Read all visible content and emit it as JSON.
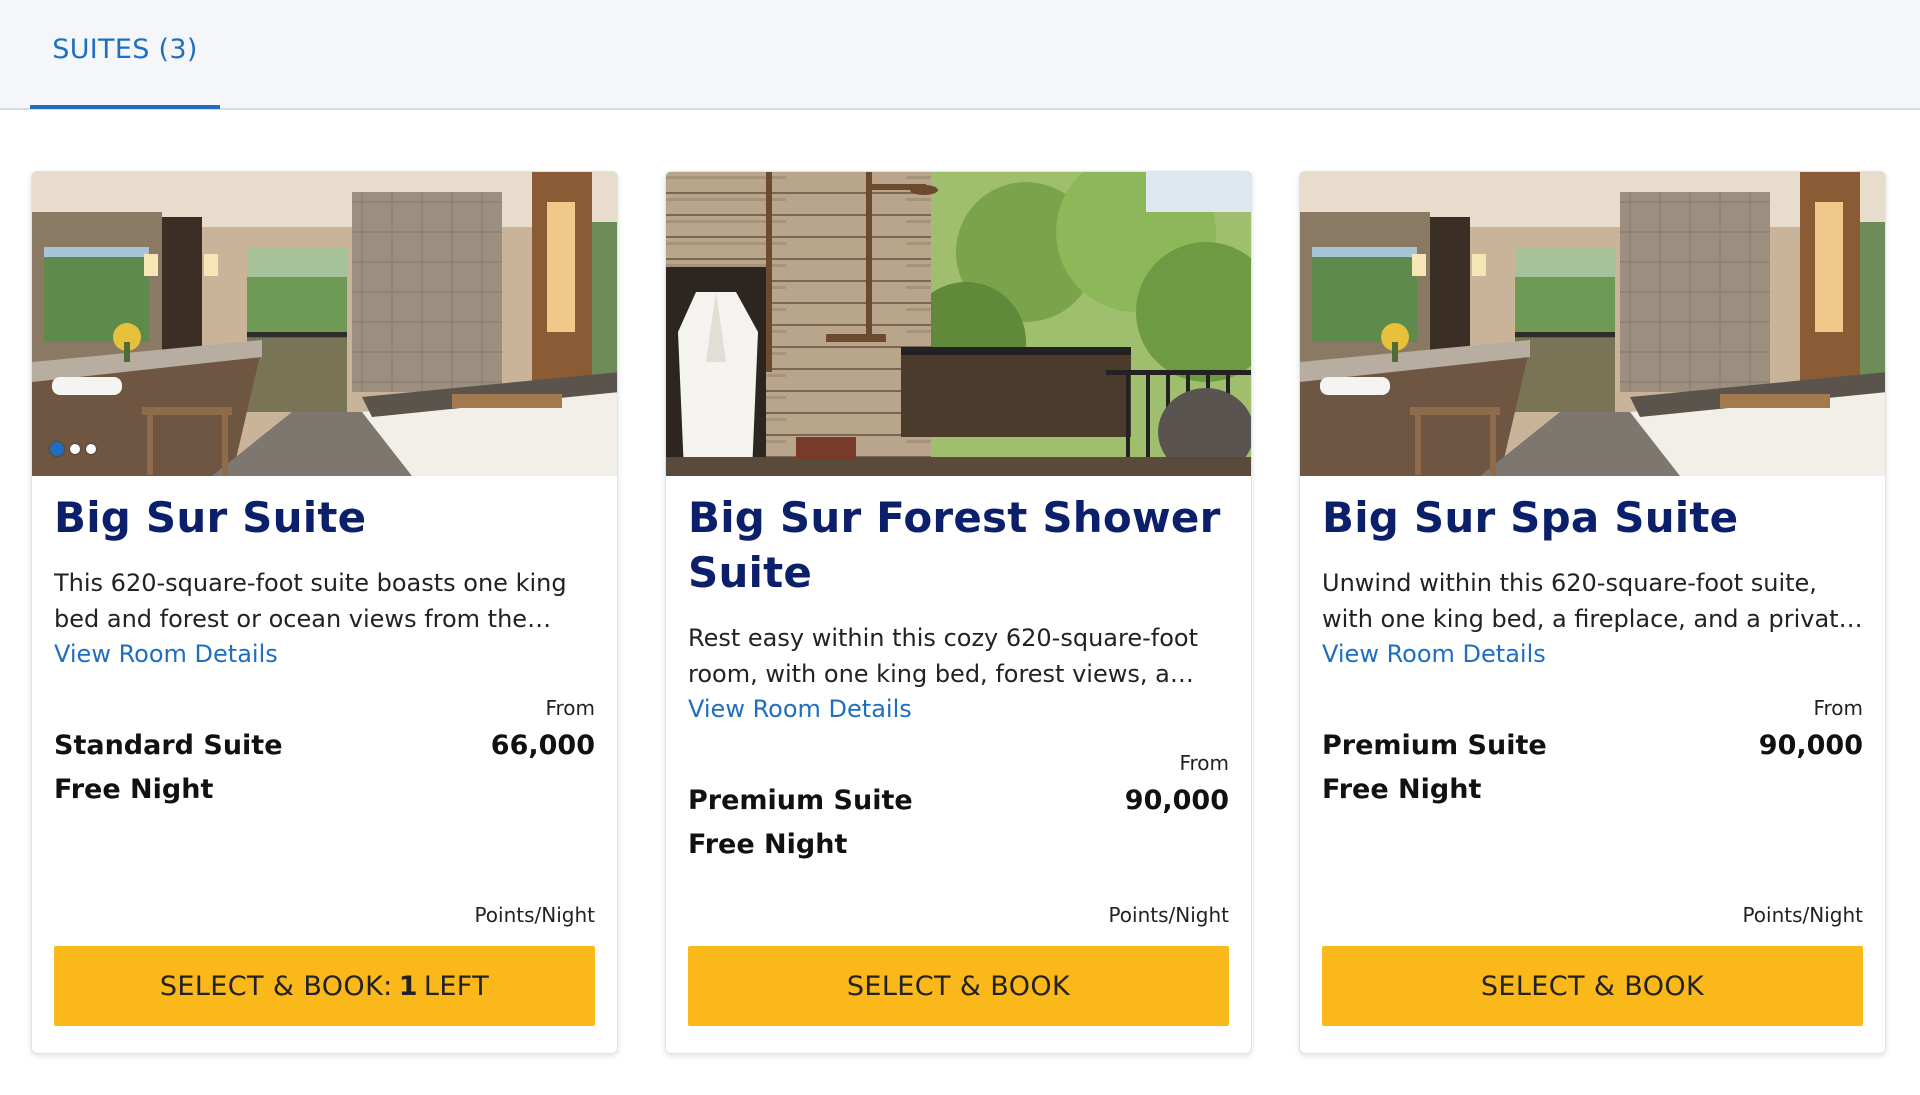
{
  "tabs": [
    {
      "label": "SUITES (3)",
      "active": true
    }
  ],
  "accent_color": "#1f6ebf",
  "title_color": "#0c1f6b",
  "button_color": "#fbb81a",
  "cards": [
    {
      "name": "Big Sur Suite",
      "description": "This 620-square-foot suite boasts one king bed and forest or ocean views from the private…",
      "link_label": "View Room Details",
      "from_label": "From",
      "rate_name": "Standard Suite Free Night",
      "points": "66,000",
      "unit_label": "Points/Night",
      "button_prefix": "SELECT & BOOK:",
      "button_count": "1",
      "button_suffix": "LEFT",
      "image_subject": "bathroom-with-balcony-view",
      "carousel_dots": 3,
      "active_dot": 0
    },
    {
      "name": "Big Sur Forest Shower Suite",
      "description": "Rest easy within this cozy 620-square-foot room, with one king bed, forest views, a woo…",
      "link_label": "View Room Details",
      "from_label": "From",
      "rate_name": "Premium Suite Free Night",
      "points": "90,000",
      "unit_label": "Points/Night",
      "button_prefix": "SELECT & BOOK",
      "button_count": "",
      "button_suffix": "",
      "image_subject": "outdoor-forest-shower-with-robe"
    },
    {
      "name": "Big Sur Spa Suite",
      "description": "Unwind within this 620-square-foot suite, with one king bed, a fireplace, and a private deck…",
      "link_label": "View Room Details",
      "from_label": "From",
      "rate_name": "Premium Suite Free Night",
      "points": "90,000",
      "unit_label": "Points/Night",
      "button_prefix": "SELECT & BOOK",
      "button_count": "",
      "button_suffix": "",
      "image_subject": "bathroom-with-balcony-view"
    }
  ]
}
